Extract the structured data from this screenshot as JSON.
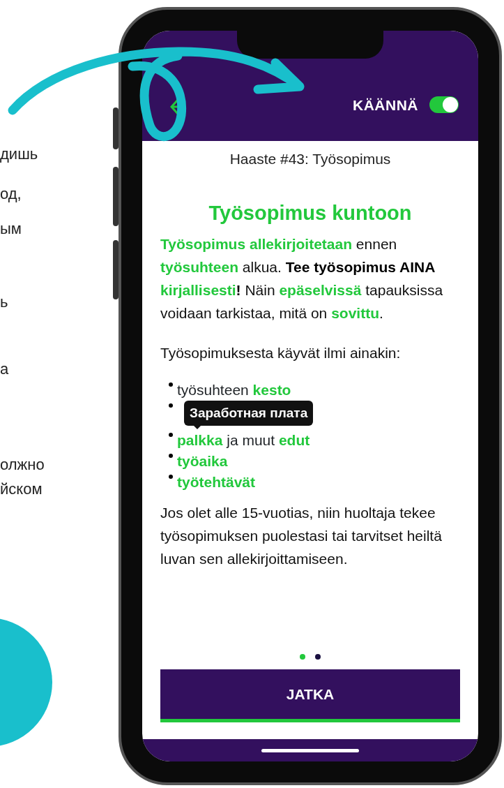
{
  "side_text": [
    "дишь",
    "од,",
    "ым",
    "ь",
    "а",
    "олжно",
    "йском"
  ],
  "header": {
    "toggle_label": "KÄÄNNÄ",
    "toggle_on": true
  },
  "challenge_title": "Haaste #43: Työsopimus",
  "heading": "Työsopimus kuntoon",
  "intro": [
    {
      "kind": "term",
      "text": "Työsopimus allekirjoitetaan"
    },
    {
      "kind": "plain",
      "text": " ennen "
    },
    {
      "kind": "term",
      "text": "työsuhteen"
    },
    {
      "kind": "plain",
      "text": " alkua. "
    },
    {
      "kind": "strong",
      "text": "Tee työsopimus AINA "
    },
    {
      "kind": "term",
      "text": "kirjallisesti"
    },
    {
      "kind": "strong",
      "text": "!"
    },
    {
      "kind": "plain",
      "text": " Näin "
    },
    {
      "kind": "term",
      "text": "epäselvissä"
    },
    {
      "kind": "plain",
      "text": " tapauksissa voidaan tarkistaa, mitä on "
    },
    {
      "kind": "term",
      "text": "sovittu"
    },
    {
      "kind": "plain",
      "text": "."
    }
  ],
  "list_intro": "Työsopimuksesta käyvät ilmi ainakin:",
  "bullets": [
    {
      "kind": "text",
      "segments": [
        {
          "kind": "plain",
          "text": "työsuhteen "
        },
        {
          "kind": "term",
          "text": "kesto"
        }
      ]
    },
    {
      "kind": "tooltip",
      "text": "Заработная плата"
    },
    {
      "kind": "text",
      "segments": [
        {
          "kind": "term",
          "text": "palkka"
        },
        {
          "kind": "plain",
          "text": " ja muut "
        },
        {
          "kind": "term",
          "text": "edut"
        }
      ]
    },
    {
      "kind": "text",
      "segments": [
        {
          "kind": "term",
          "text": "työaika"
        }
      ]
    },
    {
      "kind": "text",
      "segments": [
        {
          "kind": "term",
          "text": "työtehtävät"
        }
      ]
    }
  ],
  "note": "Jos olet alle 15-vuotias, niin huoltaja tekee työsopimuksen puolestasi tai tarvitset heiltä luvan sen allekirjoittamiseen.",
  "pages": [
    {
      "selected": true
    },
    {
      "selected": false
    }
  ],
  "continue_button": "JATKA"
}
